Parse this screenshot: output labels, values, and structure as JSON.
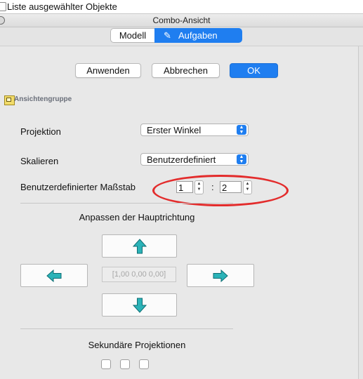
{
  "top_strip": {
    "text": "Liste ausgewählter Objekte"
  },
  "window": {
    "title": "Combo-Ansicht"
  },
  "tabs": [
    {
      "label": "Modell",
      "active": false
    },
    {
      "label": "Aufgaben",
      "active": true,
      "icon": "pencil-icon"
    }
  ],
  "buttons": {
    "apply": "Anwenden",
    "cancel": "Abbrechen",
    "ok": "OK"
  },
  "group": {
    "title": "Ansichtengruppe",
    "icon": "view-group-icon"
  },
  "fields": {
    "projection_label": "Projektion",
    "projection_value": "Erster Winkel",
    "scale_label": "Skalieren",
    "scale_value": "Benutzerdefiniert",
    "custom_scale_label": "Benutzerdefinierter Maßstab",
    "scale_numerator": "1",
    "scale_separator": ":",
    "scale_denominator": "2"
  },
  "direction": {
    "title": "Anpassen der Hauptrichtung",
    "vector": "[1,00 0,00 0,00]"
  },
  "secondary": {
    "title": "Sekundäre Projektionen",
    "checkboxes": [
      false,
      false,
      false
    ]
  },
  "colors": {
    "accent": "#1f7ef0",
    "annotation": "#e32c2c",
    "arrow": "#2bb3b8"
  }
}
